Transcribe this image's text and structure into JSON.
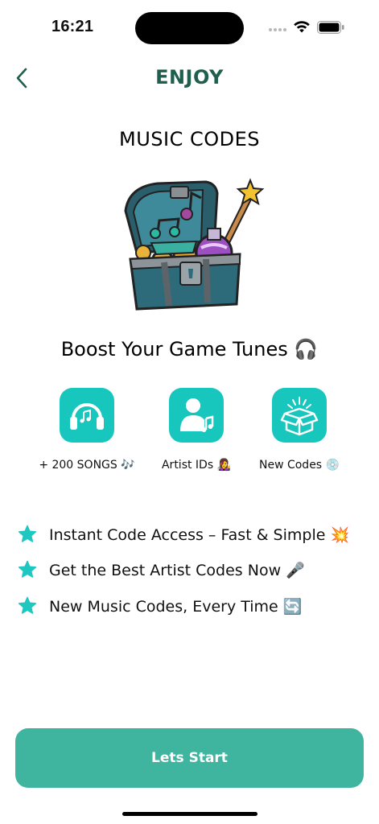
{
  "status_bar": {
    "time": "16:21",
    "icons": [
      "cellular-dots-icon",
      "wifi-icon",
      "battery-icon"
    ]
  },
  "nav": {
    "back_icon": "chevron-left-icon",
    "title": "ENJOY"
  },
  "section_title": "MUSIC CODES",
  "hero_image": "treasure-chest-music-illustration",
  "headline": "Boost Your Game Tunes 🎧",
  "features": [
    {
      "icon": "headphones-music-icon",
      "label": "+ 200 SONGS 🎶"
    },
    {
      "icon": "artist-music-icon",
      "label": "Artist IDs 👩‍🎤"
    },
    {
      "icon": "open-box-icon",
      "label": "New Codes 💿"
    }
  ],
  "bullets": [
    {
      "icon": "star-icon",
      "text": "Instant Code Access – Fast & Simple 💥"
    },
    {
      "icon": "star-icon",
      "text": "Get the Best Artist Codes Now 🎤"
    },
    {
      "icon": "star-icon",
      "text": "New Music Codes, Every Time 🔄"
    }
  ],
  "cta": {
    "label": "Lets Start"
  },
  "colors": {
    "accent": "#3fb59f",
    "title_green": "#1f5f4d",
    "feature_teal": "#17c6bc",
    "star_teal": "#1ec7c0"
  }
}
